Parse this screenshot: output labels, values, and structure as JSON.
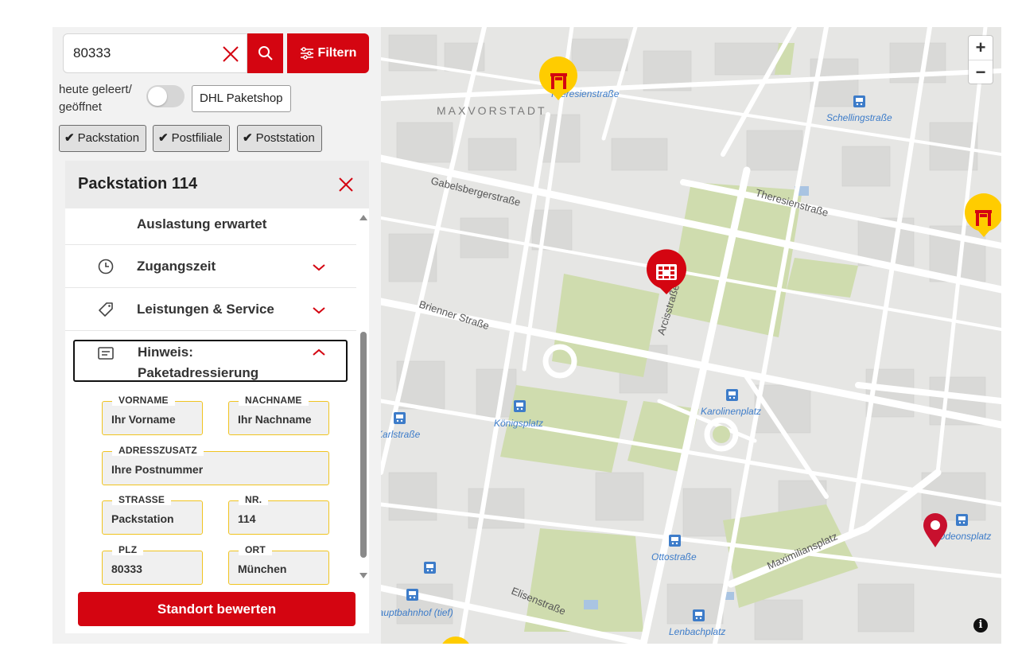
{
  "search": {
    "value": "80333"
  },
  "filter_button": {
    "label": "Filtern"
  },
  "open_today": {
    "label": "heute geleert/ geöffnet",
    "toggle_on": false
  },
  "dhl_paketshop": {
    "label": "DHL Paketshop"
  },
  "type_chips": [
    {
      "label": "Packstation",
      "checked": true
    },
    {
      "label": "Postfiliale",
      "checked": true
    },
    {
      "label": "Poststation",
      "checked": true
    }
  ],
  "detail_panel": {
    "title": "Packstation 114",
    "rows": [
      {
        "label": "Auslastung erwartet"
      },
      {
        "label": "Zugangszeit",
        "icon": "clock-icon",
        "expanded": false
      },
      {
        "label": "Leistungen & Service",
        "icon": "tag-icon",
        "expanded": false
      },
      {
        "label": "Hinweis: Paketadressierung",
        "icon": "note-icon",
        "expanded": true
      }
    ],
    "address_form": {
      "vorname": {
        "label": "VORNAME",
        "value": "Ihr Vorname"
      },
      "nachname": {
        "label": "NACHNAME",
        "value": "Ihr Nachname"
      },
      "adresszusatz": {
        "label": "ADRESSZUSATZ",
        "value": "Ihre Postnummer"
      },
      "strasse": {
        "label": "STRASSE",
        "value": "Packstation"
      },
      "nr": {
        "label": "NR.",
        "value": "114"
      },
      "plz": {
        "label": "PLZ",
        "value": "80333"
      },
      "ort": {
        "label": "ORT",
        "value": "München"
      }
    },
    "rate_button": {
      "label": "Standort bewerten"
    }
  },
  "map": {
    "zoom_in": "+",
    "zoom_out": "−",
    "info": "i",
    "district_labels": [
      "MAXVORSTADT"
    ],
    "street_labels": [
      "Gabelsbergerstraße",
      "Theresienstraße",
      "Brienner Straße",
      "Arcisstraße",
      "Maximiliansplatz",
      "Elisenstraße"
    ],
    "station_labels": [
      "Theresienstraße",
      "Schellingstraße",
      "Königsplatz",
      "Karolinenplatz",
      "Karlstraße",
      "Ottostraße",
      "Odeonsplatz",
      "Hauptbahnhof (tief)",
      "Lenbachplatz"
    ],
    "colors": {
      "accent_red": "#d40511",
      "marker_yellow": "#ffcc00",
      "park_green": "#cfdcae",
      "transit_blue": "#3d7cc9"
    }
  }
}
